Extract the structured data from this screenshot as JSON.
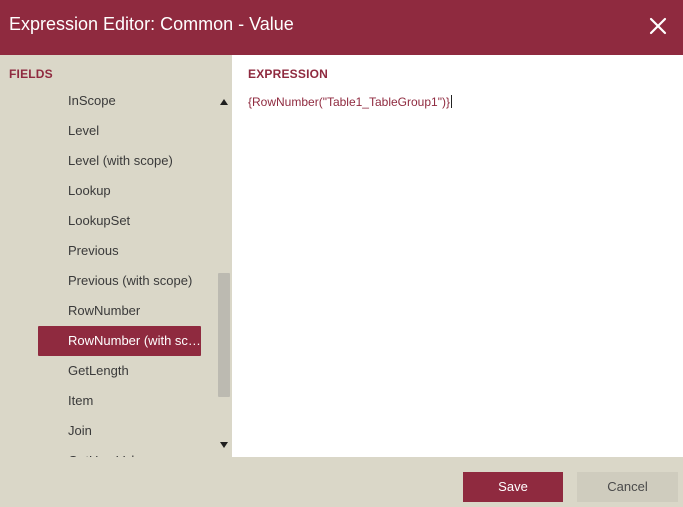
{
  "dialog": {
    "title": "Expression Editor: Common - Value",
    "close_icon": "close-icon"
  },
  "fields": {
    "header": "FIELDS",
    "items": [
      {
        "label": "InScope",
        "selected": false
      },
      {
        "label": "Level",
        "selected": false
      },
      {
        "label": "Level (with scope)",
        "selected": false
      },
      {
        "label": "Lookup",
        "selected": false
      },
      {
        "label": "LookupSet",
        "selected": false
      },
      {
        "label": "Previous",
        "selected": false
      },
      {
        "label": "Previous (with scope)",
        "selected": false
      },
      {
        "label": "RowNumber",
        "selected": false
      },
      {
        "label": "RowNumber (with scope)",
        "selected": true
      },
      {
        "label": "GetLength",
        "selected": false
      },
      {
        "label": "Item",
        "selected": false
      },
      {
        "label": "Join",
        "selected": false
      },
      {
        "label": "GetUserValue",
        "selected": false
      }
    ]
  },
  "expression": {
    "header": "EXPRESSION",
    "value": "{RowNumber(\"Table1_TableGroup1\")}"
  },
  "footer": {
    "save_label": "Save",
    "cancel_label": "Cancel"
  },
  "colors": {
    "accent": "#8f2a3f",
    "panel": "#dad7c8"
  }
}
